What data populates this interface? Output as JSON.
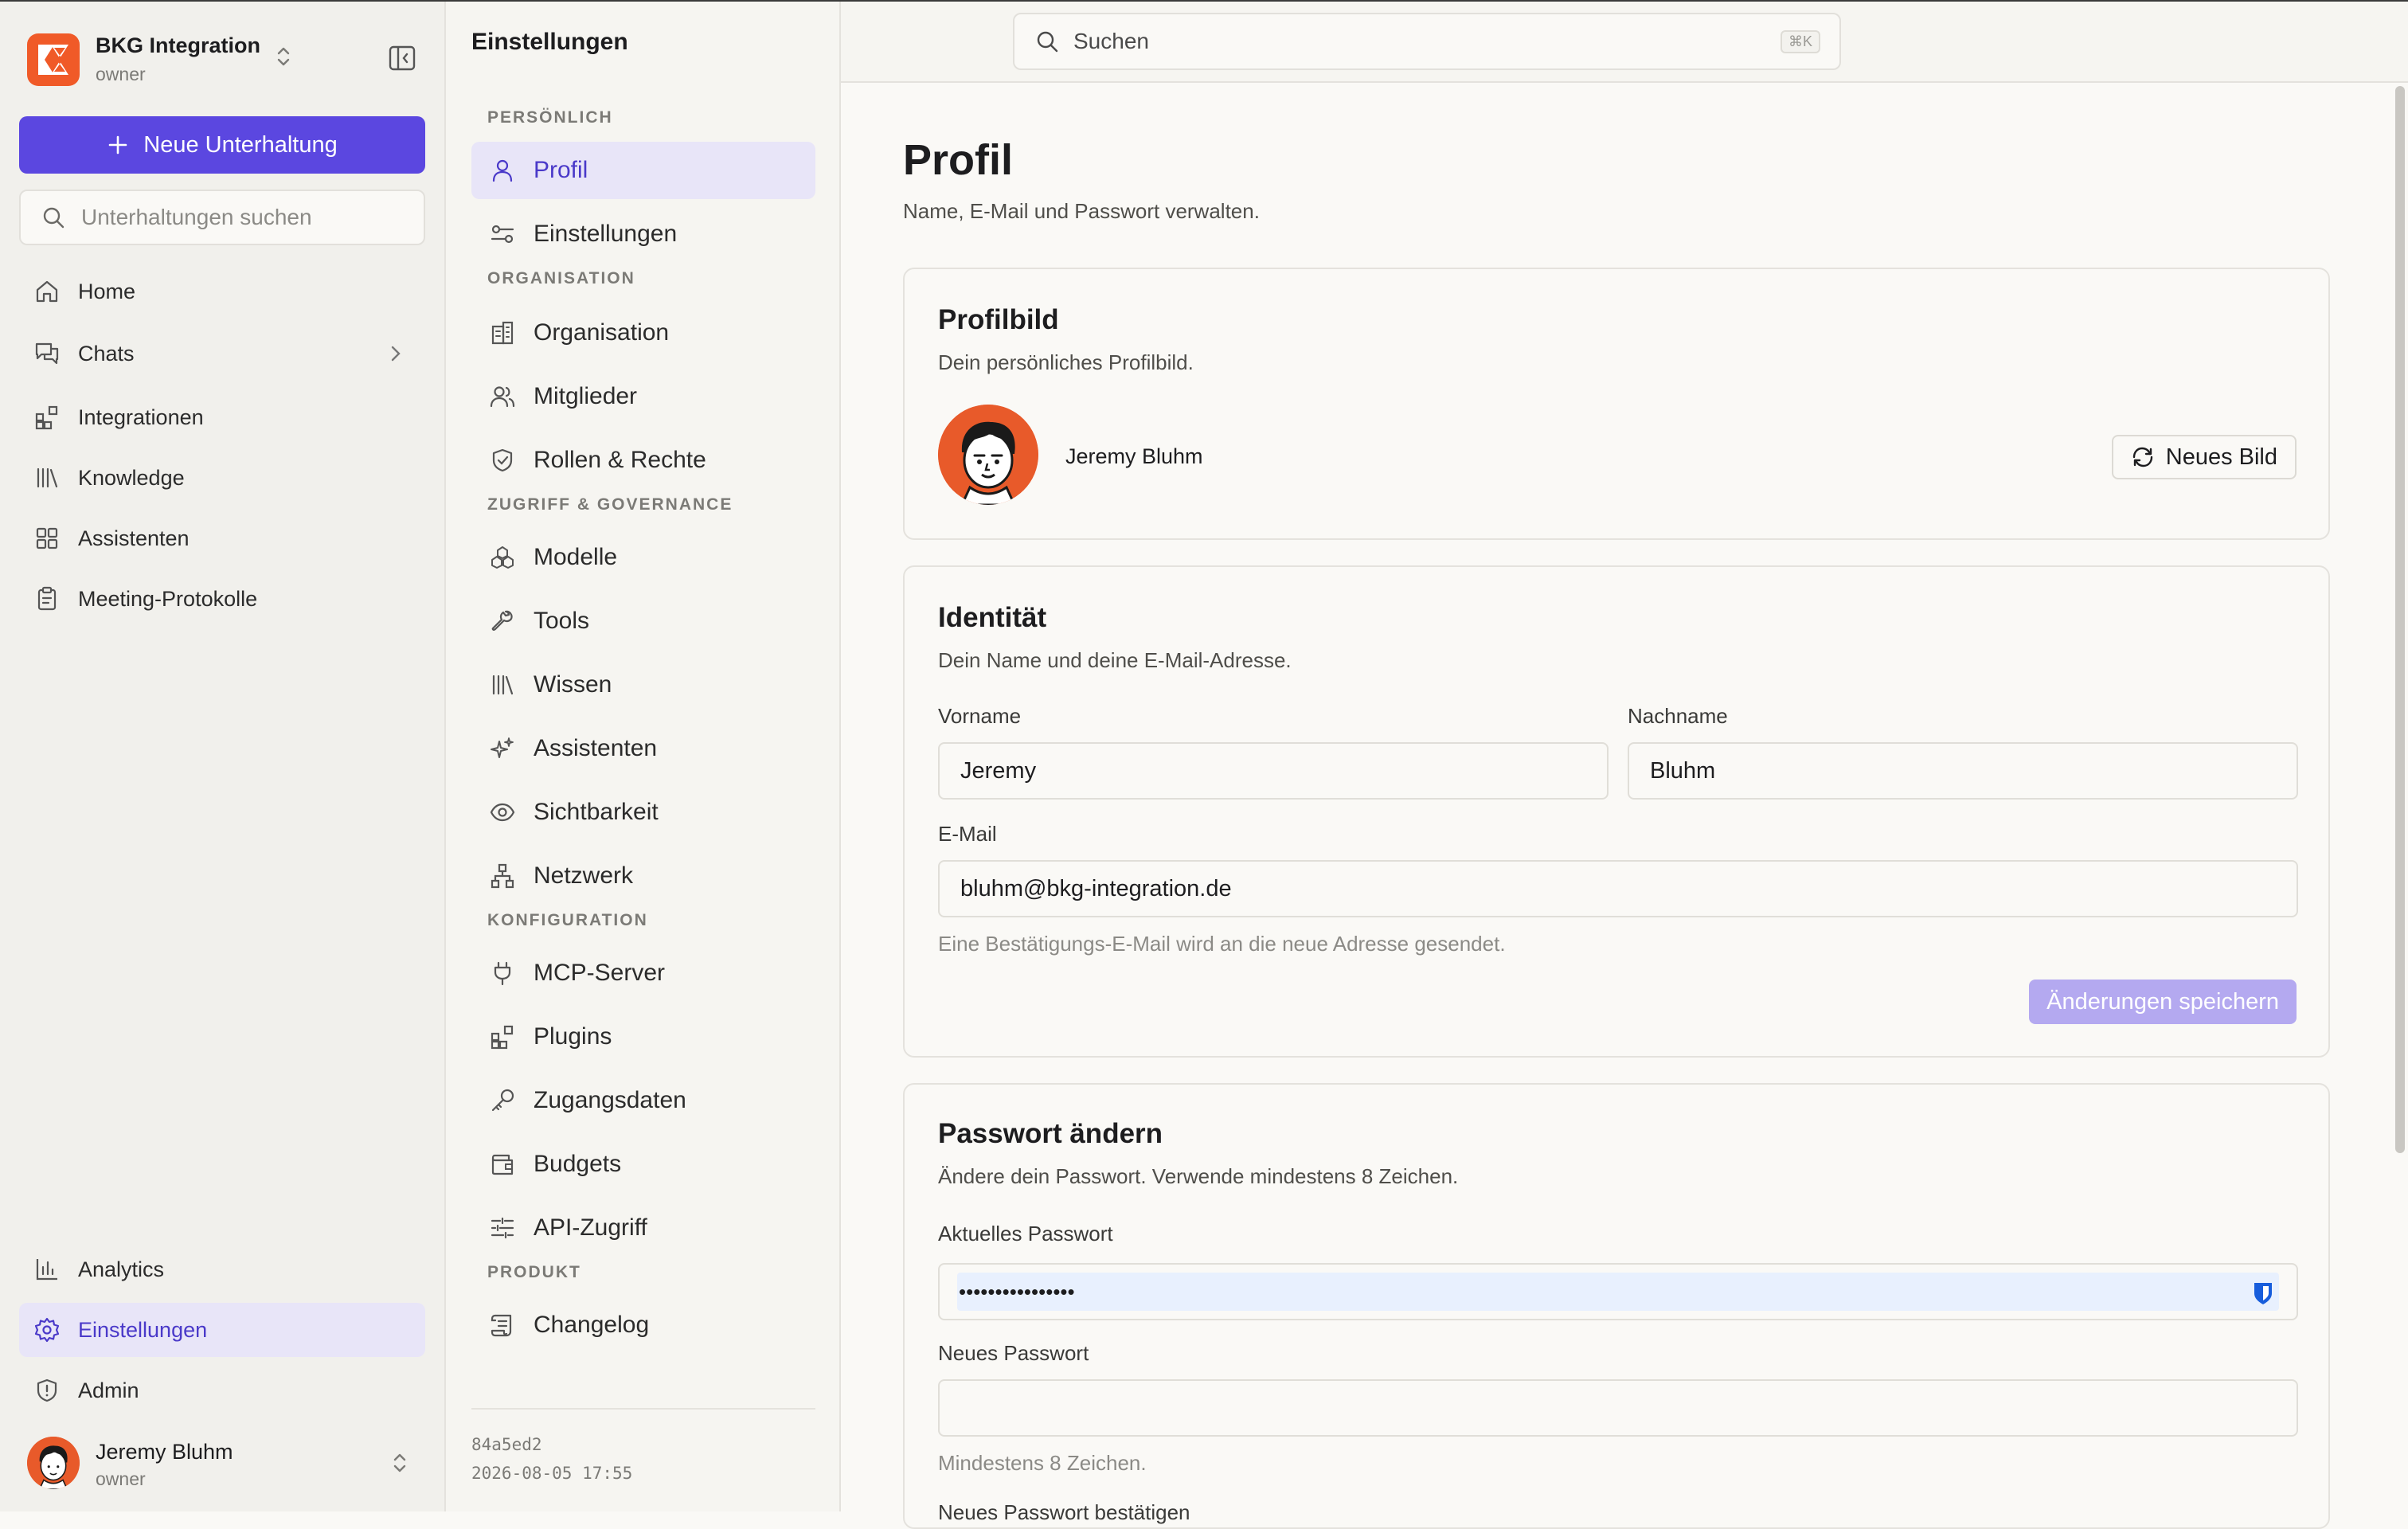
{
  "workspace": {
    "name": "BKG Integration",
    "role": "owner"
  },
  "sidebar": {
    "new_chat_label": "Neue Unterhaltung",
    "search_placeholder": "Unterhaltungen suchen",
    "items": [
      {
        "label": "Home",
        "icon": "home-icon"
      },
      {
        "label": "Chats",
        "icon": "chat-icon"
      },
      {
        "label": "Integrationen",
        "icon": "integrations-icon"
      },
      {
        "label": "Knowledge",
        "icon": "library-icon"
      },
      {
        "label": "Assistenten",
        "icon": "grid-icon"
      },
      {
        "label": "Meeting-Protokolle",
        "icon": "clipboard-icon"
      }
    ],
    "bottom_items": [
      {
        "label": "Analytics",
        "icon": "chart-icon"
      },
      {
        "label": "Einstellungen",
        "icon": "gear-icon",
        "active": true
      },
      {
        "label": "Admin",
        "icon": "shield-alert-icon"
      }
    ],
    "user": {
      "name": "Jeremy Bluhm",
      "role": "owner"
    }
  },
  "settings_nav": {
    "title": "Einstellungen",
    "sections": [
      {
        "heading": "PERSÖNLICH",
        "items": [
          "Profil",
          "Einstellungen"
        ]
      },
      {
        "heading": "ORGANISATION",
        "items": [
          "Organisation",
          "Mitglieder",
          "Rollen & Rechte"
        ]
      },
      {
        "heading": "ZUGRIFF & GOVERNANCE",
        "items": [
          "Modelle",
          "Tools",
          "Wissen",
          "Assistenten",
          "Sichtbarkeit",
          "Netzwerk"
        ]
      },
      {
        "heading": "KONFIGURATION",
        "items": [
          "MCP-Server",
          "Plugins",
          "Zugangsdaten",
          "Budgets",
          "API-Zugriff"
        ]
      },
      {
        "heading": "PRODUKT",
        "items": [
          "Changelog"
        ]
      }
    ],
    "active": "Profil",
    "build_hash": "84a5ed2",
    "build_date": "2026-08-05 17:55"
  },
  "search": {
    "placeholder": "Suchen",
    "shortcut": "⌘K"
  },
  "page": {
    "title": "Profil",
    "subtitle": "Name, E-Mail und Passwort verwalten."
  },
  "profile_picture": {
    "title": "Profilbild",
    "subtitle": "Dein persönliches Profilbild.",
    "name": "Jeremy Bluhm",
    "button": "Neues Bild"
  },
  "identity": {
    "title": "Identität",
    "subtitle": "Dein Name und deine E-Mail-Adresse.",
    "first_name_label": "Vorname",
    "first_name": "Jeremy",
    "last_name_label": "Nachname",
    "last_name": "Bluhm",
    "email_label": "E-Mail",
    "email": "bluhm@bkg-integration.de",
    "email_hint": "Eine Bestätigungs-E-Mail wird an die neue Adresse gesendet.",
    "save_button": "Änderungen speichern"
  },
  "password": {
    "title": "Passwort ändern",
    "subtitle": "Ändere dein Passwort. Verwende mindestens 8 Zeichen.",
    "current_label": "Aktuelles Passwort",
    "current_value": "••••••••••••••••",
    "new_label": "Neues Passwort",
    "new_hint": "Mindestens 8 Zeichen.",
    "confirm_label": "Neues Passwort bestätigen"
  },
  "colors": {
    "accent": "#5b47e0",
    "accent_soft": "#e8e5f8",
    "brand": "#f05a28"
  }
}
